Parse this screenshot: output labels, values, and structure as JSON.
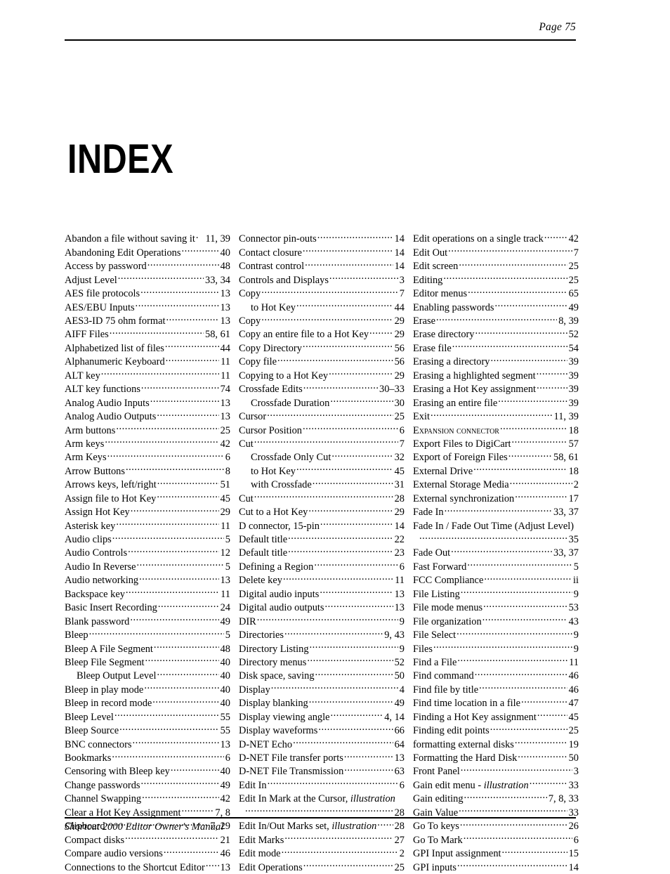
{
  "header": {
    "page_label": "Page 75"
  },
  "title": "INDEX",
  "footer": {
    "manual_title": "Shortcut 2000 Editor Owner's Manual"
  },
  "columns": [
    {
      "entries": [
        {
          "term": "Abandon a file without saving it",
          "pages": "11, 39",
          "leader": "dot1"
        },
        {
          "term": "Abandoning Edit Operations",
          "pages": "40"
        },
        {
          "term": "Access by password",
          "pages": "48"
        },
        {
          "term": "Adjust Level",
          "pages": "33, 34"
        },
        {
          "term": "AES file protocols",
          "pages": "13"
        },
        {
          "term": "AES/EBU Inputs",
          "pages": "13"
        },
        {
          "term": "AES3-ID 75 ohm format",
          "pages": "13"
        },
        {
          "term": "AIFF Files",
          "pages": "58, 61"
        },
        {
          "term": "Alphabetized list of files",
          "pages": "44"
        },
        {
          "term": "Alphanumeric Keyboard",
          "pages": "11"
        },
        {
          "term": "ALT key",
          "pages": "11"
        },
        {
          "term": "ALT key functions",
          "pages": "74"
        },
        {
          "term": "Analog Audio Inputs",
          "pages": "13"
        },
        {
          "term": "Analog Audio Outputs",
          "pages": "13"
        },
        {
          "term": "Arm buttons",
          "pages": "25"
        },
        {
          "term": "Arm keys",
          "pages": "42"
        },
        {
          "term": "Arm Keys",
          "pages": "6"
        },
        {
          "term": "Arrow Buttons",
          "pages": "8"
        },
        {
          "term": "Arrows keys, left/right",
          "pages": "51"
        },
        {
          "term": "Assign file to Hot Key",
          "pages": "45"
        },
        {
          "term": "Assign Hot Key",
          "pages": "29"
        },
        {
          "term": "Asterisk key",
          "pages": "11"
        },
        {
          "term": "Audio clips",
          "pages": "5"
        },
        {
          "term": "Audio Controls",
          "pages": "12"
        },
        {
          "term": "Audio In Reverse",
          "pages": "5"
        },
        {
          "term": "Audio networking",
          "pages": "13"
        },
        {
          "term": "Backspace key",
          "pages": "11"
        },
        {
          "term": "Basic Insert Recording",
          "pages": "24"
        },
        {
          "term": "Blank password",
          "pages": "49"
        },
        {
          "term": "Bleep",
          "pages": "5"
        },
        {
          "term": "Bleep A File Segment",
          "pages": "48"
        },
        {
          "term": "Bleep File Segment",
          "pages": "40"
        },
        {
          "term": "Bleep Output Level",
          "pages": "40",
          "sub": true
        },
        {
          "term": "Bleep in play mode",
          "pages": "40"
        },
        {
          "term": "Bleep in record mode",
          "pages": "40"
        },
        {
          "term": "Bleep Level",
          "pages": "55"
        },
        {
          "term": "Bleep Source",
          "pages": "55"
        },
        {
          "term": "BNC connectors",
          "pages": "13"
        },
        {
          "term": "Bookmarks",
          "pages": "6"
        },
        {
          "term": "Censoring with Bleep key",
          "pages": "40"
        },
        {
          "term": "Change passwords",
          "pages": "49"
        },
        {
          "term": "Channel Swapping",
          "pages": "42"
        },
        {
          "term": "Clear a Hot Key Assignment",
          "pages": "7, 8"
        },
        {
          "term": "Clipboard",
          "pages": "7, 29"
        },
        {
          "term": "Compact disks",
          "pages": "21"
        },
        {
          "term": "Compare audio versions",
          "pages": "46"
        },
        {
          "term": "Connections to the Shortcut Editor",
          "pages": "13"
        }
      ]
    },
    {
      "entries": [
        {
          "term": "Connector pin-outs",
          "pages": "14"
        },
        {
          "term": "Contact closure",
          "pages": "14"
        },
        {
          "term": "Contrast control",
          "pages": "14"
        },
        {
          "term": "Controls and Displays",
          "pages": "3"
        },
        {
          "term": "Copy",
          "pages": "7"
        },
        {
          "term": "to Hot Key",
          "pages": "44",
          "sub": true
        },
        {
          "term": "Copy",
          "pages": "29"
        },
        {
          "term": "Copy an entire file to a Hot Key",
          "pages": "29"
        },
        {
          "term": "Copy Directory",
          "pages": "56"
        },
        {
          "term": "Copy file",
          "pages": "56"
        },
        {
          "term": "Copying to a Hot Key",
          "pages": "29"
        },
        {
          "term": "Crossfade Edits",
          "pages": "30–33"
        },
        {
          "term": "Crossfade Duration",
          "pages": "30",
          "sub": true
        },
        {
          "term": "Cursor",
          "pages": "25"
        },
        {
          "term": "Cursor Position",
          "pages": "6"
        },
        {
          "term": "Cut",
          "pages": "7"
        },
        {
          "term": "Crossfade Only Cut",
          "pages": "32",
          "sub": true
        },
        {
          "term": "to Hot Key",
          "pages": "45",
          "sub": true
        },
        {
          "term": "with Crossfade",
          "pages": "31",
          "sub": true
        },
        {
          "term": "Cut",
          "pages": "28"
        },
        {
          "term": "Cut to a Hot Key",
          "pages": "29"
        },
        {
          "term": "D connector, 15-pin",
          "pages": "14"
        },
        {
          "term": "Default title",
          "pages": "22"
        },
        {
          "term": "Default title",
          "pages": "23"
        },
        {
          "term": "Defining a Region",
          "pages": "6"
        },
        {
          "term": "Delete key",
          "pages": "11"
        },
        {
          "term": "Digital audio inputs",
          "pages": "13"
        },
        {
          "term": "Digital audio outputs",
          "pages": "13"
        },
        {
          "term": "DIR",
          "pages": "9"
        },
        {
          "term": "Directories",
          "pages": "9, 43"
        },
        {
          "term": "Directory Listing",
          "pages": "9"
        },
        {
          "term": "Directory menus",
          "pages": "52"
        },
        {
          "term": "Disk space, saving",
          "pages": "50"
        },
        {
          "term": "Display",
          "pages": "4"
        },
        {
          "term": "Display blanking",
          "pages": "49"
        },
        {
          "term": "Display viewing angle",
          "pages": "4, 14"
        },
        {
          "term": "Display waveforms",
          "pages": "66"
        },
        {
          "term": "D-NET Echo",
          "pages": "64"
        },
        {
          "term": "D-NET File transfer ports",
          "pages": "13"
        },
        {
          "term": "D-NET File Transmission",
          "pages": "63"
        },
        {
          "term": "Edit In",
          "pages": "6"
        },
        {
          "term": "Edit In Mark at the Cursor, ",
          "term_italic": "illustration",
          "pages": "",
          "leader": "none"
        },
        {
          "term": "",
          "pages": "28",
          "continuation": true
        },
        {
          "term": "Edit In/Out Marks set, ",
          "term_italic": "illustration",
          "pages": "28"
        },
        {
          "term": "Edit Marks",
          "pages": "27"
        },
        {
          "term": "Edit mode",
          "pages": "2"
        },
        {
          "term": "Edit Operations",
          "pages": "25"
        }
      ]
    },
    {
      "entries": [
        {
          "term": "Edit operations on a single track",
          "pages": "42"
        },
        {
          "term": "Edit Out",
          "pages": "7"
        },
        {
          "term": "Edit screen",
          "pages": "25"
        },
        {
          "term": "Editing",
          "pages": "25"
        },
        {
          "term": "Editor menus",
          "pages": "65"
        },
        {
          "term": "Enabling passwords",
          "pages": "49"
        },
        {
          "term": "Erase",
          "pages": "8, 39"
        },
        {
          "term": "Erase directory",
          "pages": "52"
        },
        {
          "term": "Erase file",
          "pages": "54"
        },
        {
          "term": "Erasing a directory",
          "pages": "39"
        },
        {
          "term": "Erasing a highlighted segment",
          "pages": "39"
        },
        {
          "term": "Erasing a Hot Key assignment",
          "pages": "39"
        },
        {
          "term": "Erasing an entire file",
          "pages": "39"
        },
        {
          "term": "Exit",
          "pages": "11, 39"
        },
        {
          "term": "Expansion connector",
          "pages": "18",
          "smallcaps": true
        },
        {
          "term": "Export Files to DigiCart",
          "pages": "57"
        },
        {
          "term": "Export of Foreign Files",
          "pages": "58, 61"
        },
        {
          "term": "External Drive",
          "pages": "18"
        },
        {
          "term": "External Storage Media",
          "pages": "2"
        },
        {
          "term": "External synchronization",
          "pages": "17"
        },
        {
          "term": "Fade In",
          "pages": "33, 37"
        },
        {
          "term": "Fade In / Fade Out Time (Adjust Level)",
          "pages": "",
          "leader": "none"
        },
        {
          "term": "",
          "pages": "35",
          "continuation": true
        },
        {
          "term": "Fade Out",
          "pages": "33, 37"
        },
        {
          "term": "Fast Forward",
          "pages": "5"
        },
        {
          "term": "FCC Compliance",
          "pages": "ii"
        },
        {
          "term": "File Listing",
          "pages": "9"
        },
        {
          "term": "File mode menus",
          "pages": "53"
        },
        {
          "term": "File organization",
          "pages": "43"
        },
        {
          "term": "File Select",
          "pages": "9"
        },
        {
          "term": "Files",
          "pages": "9"
        },
        {
          "term": "Find a File",
          "pages": "11"
        },
        {
          "term": "Find command",
          "pages": "46"
        },
        {
          "term": "Find file by title",
          "pages": "46"
        },
        {
          "term": "Find time location in a file",
          "pages": "47"
        },
        {
          "term": "Finding a Hot Key assignment",
          "pages": "45"
        },
        {
          "term": "Finding edit points",
          "pages": "25"
        },
        {
          "term": "formatting external disks",
          "pages": "19"
        },
        {
          "term": "Formatting the Hard Disk",
          "pages": "50"
        },
        {
          "term": "Front Panel",
          "pages": "3"
        },
        {
          "term": "Gain edit menu - ",
          "term_italic": "illustration",
          "pages": "33"
        },
        {
          "term": "Gain editing",
          "pages": "7, 8, 33"
        },
        {
          "term": "Gain Value",
          "pages": "33"
        },
        {
          "term": "Go To keys",
          "pages": "26"
        },
        {
          "term": "Go To Mark",
          "pages": "6"
        },
        {
          "term": "GPI Input assignment",
          "pages": "15"
        },
        {
          "term": "GPI inputs",
          "pages": "14"
        }
      ]
    }
  ]
}
